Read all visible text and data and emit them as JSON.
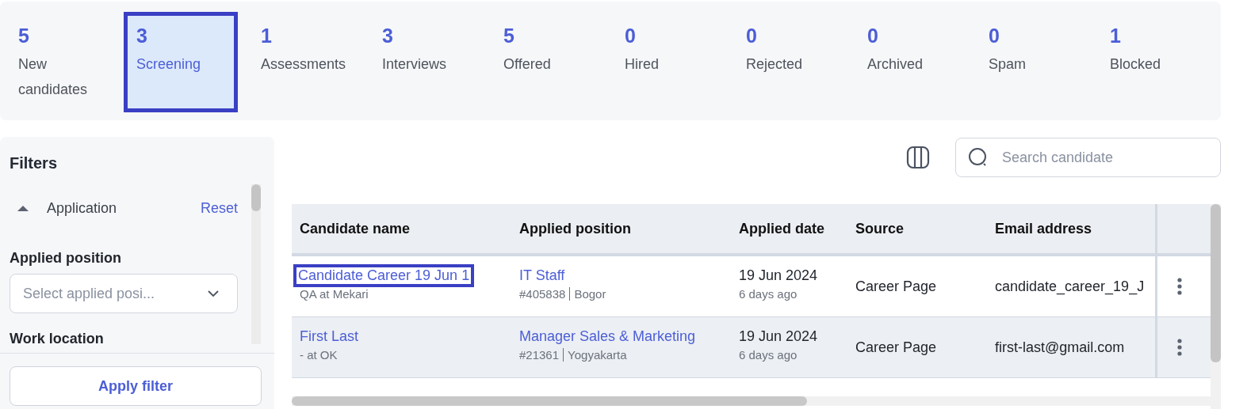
{
  "stages": [
    {
      "count": "5",
      "label": "New candidates",
      "selected": false
    },
    {
      "count": "3",
      "label": "Screening",
      "selected": true
    },
    {
      "count": "1",
      "label": "Assessments",
      "selected": false
    },
    {
      "count": "3",
      "label": "Interviews",
      "selected": false
    },
    {
      "count": "5",
      "label": "Offered",
      "selected": false
    },
    {
      "count": "0",
      "label": "Hired",
      "selected": false
    },
    {
      "count": "0",
      "label": "Rejected",
      "selected": false
    },
    {
      "count": "0",
      "label": "Archived",
      "selected": false
    },
    {
      "count": "0",
      "label": "Spam",
      "selected": false
    },
    {
      "count": "1",
      "label": "Blocked",
      "selected": false
    }
  ],
  "filters": {
    "title": "Filters",
    "section": {
      "label": "Application",
      "expanded": true,
      "reset": "Reset"
    },
    "applied_position": {
      "label": "Applied position",
      "placeholder": "Select applied posi..."
    },
    "work_location": {
      "label": "Work location"
    },
    "apply_button": "Apply filter"
  },
  "search": {
    "placeholder": "Search candidate"
  },
  "table": {
    "columns": [
      "Candidate name",
      "Applied position",
      "Applied date",
      "Source",
      "Email address"
    ],
    "rows": [
      {
        "name": "Candidate Career 19 Jun 1",
        "focused": true,
        "subtitle": "QA at Mekari",
        "position": "IT Staff",
        "job_id": "#405838",
        "city": "Bogor",
        "date": "19 Jun 2024",
        "ago": "6 days ago",
        "source": "Career Page",
        "email": "candidate_career_19_J"
      },
      {
        "name": "First Last",
        "focused": false,
        "subtitle": "- at OK",
        "position": "Manager Sales & Marketing",
        "job_id": "#21361",
        "city": "Yogyakarta",
        "date": "19 Jun 2024",
        "ago": "6 days ago",
        "source": "Career Page",
        "email": "first-last@gmail.com"
      }
    ]
  }
}
